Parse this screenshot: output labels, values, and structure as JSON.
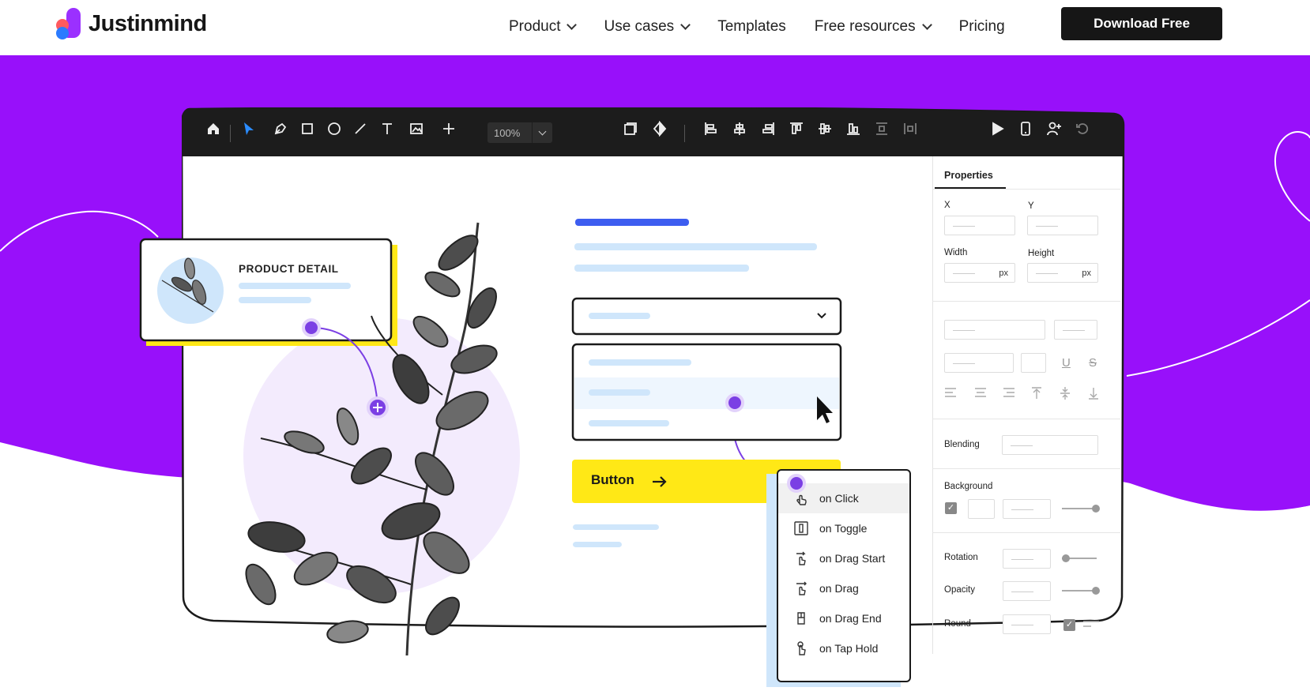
{
  "brand": {
    "name": "Justinmind",
    "colors": {
      "purple": "#9810fa",
      "yellow": "#ffe816",
      "dark": "#161616",
      "accent_blue": "#3d5df0",
      "light_blue": "#cfe6fb"
    }
  },
  "nav": {
    "items": [
      {
        "label": "Product",
        "has_dropdown": true
      },
      {
        "label": "Use cases",
        "has_dropdown": true
      },
      {
        "label": "Templates",
        "has_dropdown": false
      },
      {
        "label": "Free resources",
        "has_dropdown": true
      },
      {
        "label": "Pricing",
        "has_dropdown": false
      }
    ],
    "cta": "Download Free"
  },
  "editor": {
    "toolbar": {
      "zoom": "100%",
      "icons": [
        "home-icon",
        "select-arrow-icon",
        "pen-icon",
        "rectangle-icon",
        "ellipse-icon",
        "line-icon",
        "text-icon",
        "image-icon",
        "add-icon",
        "components-icon",
        "mask-icon",
        "align-left-icon",
        "align-center-icon",
        "align-right-icon",
        "align-top-icon",
        "align-middle-icon",
        "align-bottom-icon",
        "distribute-vertical-icon",
        "distribute-horizontal-icon",
        "play-icon",
        "mobile-device-icon",
        "add-user-icon",
        "undo-icon"
      ]
    },
    "canvas": {
      "card_title": "PRODUCT DETAIL",
      "button_label": "Button"
    },
    "events_menu": {
      "items": [
        {
          "label": "on Click",
          "icon": "click-hand-icon",
          "selected": true
        },
        {
          "label": "on Toggle",
          "icon": "toggle-icon",
          "selected": false
        },
        {
          "label": "on Drag Start",
          "icon": "drag-start-icon",
          "selected": false
        },
        {
          "label": "on Drag",
          "icon": "drag-icon",
          "selected": false
        },
        {
          "label": "on Drag End",
          "icon": "drag-end-icon",
          "selected": false
        },
        {
          "label": "on Tap Hold",
          "icon": "tap-hold-icon",
          "selected": false
        }
      ]
    },
    "properties": {
      "tab": "Properties",
      "x_label": "X",
      "y_label": "Y",
      "width_label": "Width",
      "height_label": "Height",
      "unit": "px",
      "blending_label": "Blending",
      "background_label": "Background",
      "rotation_label": "Rotation",
      "opacity_label": "Opacity",
      "round_label": "Round",
      "text_underline": "U",
      "text_strike": "S",
      "background_checked": true,
      "round_checked": true
    }
  }
}
